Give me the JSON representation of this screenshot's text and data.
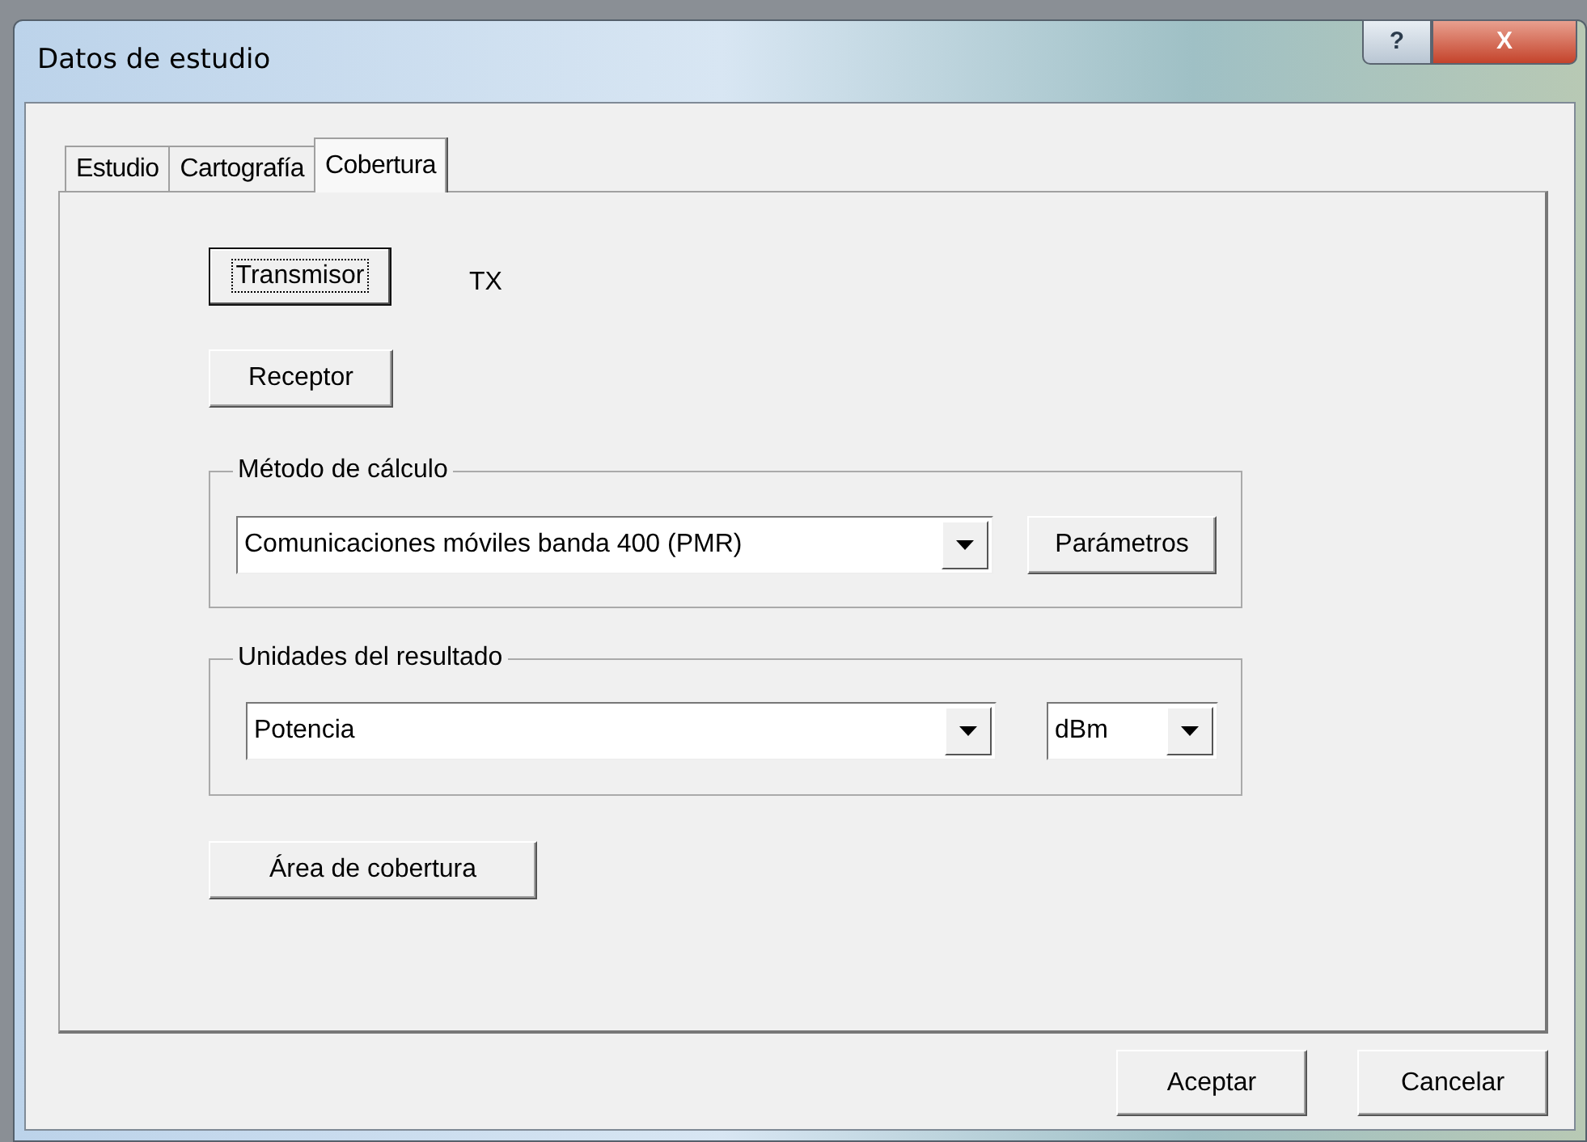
{
  "window": {
    "title": "Datos de estudio",
    "caption_buttons": [
      {
        "kind": "help",
        "label": "?"
      },
      {
        "kind": "close",
        "label": "X"
      }
    ]
  },
  "tabs": [
    {
      "label": "Estudio",
      "selected": false
    },
    {
      "label": "Cartografía",
      "selected": false
    },
    {
      "label": "Cobertura",
      "selected": true
    }
  ],
  "transmitter": {
    "button": "Transmisor",
    "focused": true,
    "value": "TX"
  },
  "receiver": {
    "button": "Receptor",
    "focused": false
  },
  "calculation_method": {
    "legend": "Método de cálculo",
    "value": "Comunicaciones móviles banda 400 (PMR)",
    "button": "Parámetros"
  },
  "result_units": {
    "legend": "Unidades del resultado",
    "value": "Potencia",
    "unit": "dBm"
  },
  "coverage_area_button": "Área de cobertura",
  "footer_buttons": [
    "Aceptar",
    "Cancelar"
  ]
}
